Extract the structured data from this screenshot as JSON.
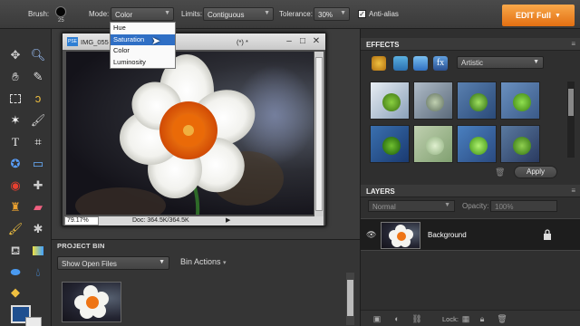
{
  "options_bar": {
    "brush_label": "Brush:",
    "brush_size": "25",
    "mode_label": "Mode:",
    "mode_value": "Color",
    "limits_label": "Limits:",
    "limits_value": "Contiguous",
    "tolerance_label": "Tolerance:",
    "tolerance_value": "30%",
    "antialias_label": "Anti-alias",
    "antialias_checked": true,
    "edit_full_label": "EDIT Full"
  },
  "mode_menu": {
    "options": [
      "Hue",
      "Saturation",
      "Color",
      "Luminosity"
    ],
    "highlighted": "Saturation"
  },
  "document": {
    "title": "IMG_055",
    "title_tail": "(*) *",
    "zoom": "79.17%",
    "doc_size": "Doc: 364.5K/364.5K"
  },
  "project_bin": {
    "title": "PROJECT BIN",
    "show_select": "Show Open Files",
    "bin_actions_label": "Bin Actions"
  },
  "effects_panel": {
    "title": "EFFECTS",
    "category_select": "Artistic",
    "apply_label": "Apply"
  },
  "layers_panel": {
    "title": "LAYERS",
    "blend_mode": "Normal",
    "opacity_label": "Opacity:",
    "opacity_value": "100%",
    "lock_label": "Lock:",
    "layers": [
      {
        "name": "Background",
        "visible": true,
        "locked": true
      }
    ]
  },
  "colors": {
    "accent_orange": "#f08a24",
    "foreground_color": "#1f4f8f",
    "background_color": "#eaeaea",
    "menu_highlight": "#2f6fc5"
  },
  "icons": {
    "tools": [
      "move-tool-icon",
      "zoom-tool-icon",
      "hand-tool-icon",
      "eyedropper-tool-icon",
      "marquee-tool-icon",
      "lasso-tool-icon",
      "magic-wand-tool-icon",
      "quick-selection-tool-icon",
      "type-tool-icon",
      "crop-tool-icon",
      "cookie-cutter-tool-icon",
      "straighten-tool-icon",
      "red-eye-tool-icon",
      "healing-brush-tool-icon",
      "clone-stamp-tool-icon",
      "eraser-tool-icon",
      "brush-tool-icon",
      "smart-brush-tool-icon",
      "paint-bucket-tool-icon",
      "gradient-tool-icon",
      "shape-tool-icon",
      "blur-tool-icon",
      "sponge-tool-icon"
    ]
  }
}
